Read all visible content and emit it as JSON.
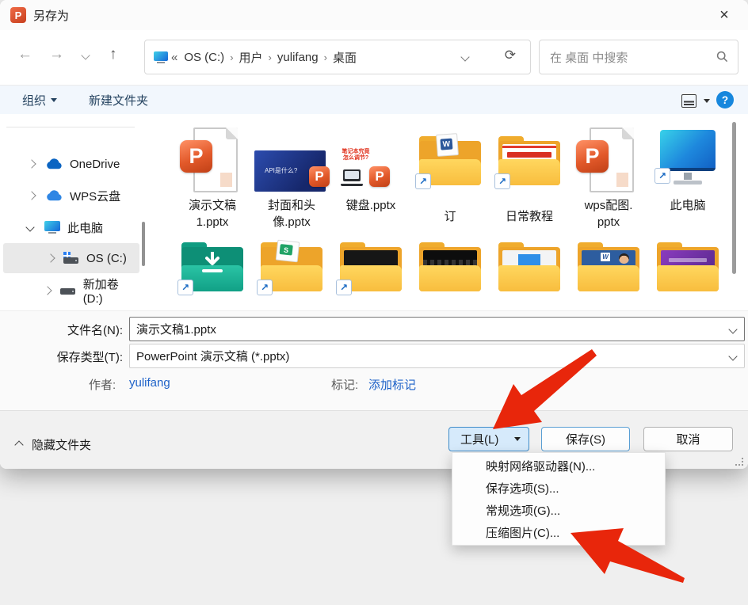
{
  "window": {
    "title": "另存为"
  },
  "nav": {
    "address": {
      "root": "«",
      "separator": "›",
      "crumbs": [
        "OS (C:)",
        "用户",
        "yulifang",
        "桌面"
      ]
    },
    "search_placeholder": "在 桌面 中搜索"
  },
  "toolbar": {
    "organize": "组织",
    "new_folder": "新建文件夹"
  },
  "sidebar": {
    "items": [
      {
        "label": "OneDrive"
      },
      {
        "label": "WPS云盘"
      },
      {
        "label": "此电脑"
      },
      {
        "label": "OS (C:)"
      },
      {
        "label": "新加卷 (D:)"
      }
    ]
  },
  "files": {
    "row1": [
      {
        "name": "演示文稿1.pptx",
        "line1": "演示文稿",
        "line2": "1.pptx"
      },
      {
        "name": "封面和头像.pptx",
        "line1": "封面和头",
        "line2": "像.pptx",
        "thumb_text": "API是什么?"
      },
      {
        "name": "键盘.pptx",
        "line1": "键盘.pptx",
        "line2": "",
        "thumb_line1": "笔记本究竟",
        "thumb_line2": "怎么调节?"
      },
      {
        "name": "订",
        "line1": "订",
        "line2": ""
      },
      {
        "name": "日常教程",
        "line1": "日常教程",
        "line2": ""
      },
      {
        "name": "wps配图.pptx",
        "line1": "wps配图.",
        "line2": "pptx"
      },
      {
        "name": "此电脑",
        "line1": "此电脑",
        "line2": ""
      }
    ],
    "row2": [
      {
        "type": "teal-download-folder"
      },
      {
        "type": "spreadsheet-folder"
      },
      {
        "type": "dark-content-folder"
      },
      {
        "type": "keyboard-folder"
      },
      {
        "type": "presentation-folder"
      },
      {
        "type": "word-avatar-folder"
      },
      {
        "type": "purple-folder"
      }
    ]
  },
  "fields": {
    "filename_label": "文件名(N):",
    "filename_value": "演示文稿1.pptx",
    "savetype_label": "保存类型(T):",
    "savetype_value": "PowerPoint 演示文稿 (*.pptx)",
    "author_label": "作者:",
    "author_value": "yulifang",
    "tags_label": "标记:",
    "tags_value": "添加标记"
  },
  "footer": {
    "hide_folders": "隐藏文件夹",
    "tools": "工具(L)",
    "save": "保存(S)",
    "cancel": "取消"
  },
  "menu": {
    "items": [
      "映射网络驱动器(N)...",
      "保存选项(S)...",
      "常规选项(G)...",
      "压缩图片(C)..."
    ]
  },
  "glyphs": {
    "back": "←",
    "forward": "→",
    "up": "↑",
    "refresh": "⟳",
    "close": "×",
    "shortcut": "↗",
    "p_letter": "P",
    "w_letter": "W",
    "s_letter": "S",
    "help": "?"
  },
  "colors": {
    "accent": "#1787dd",
    "arrow_red": "#e8260b",
    "folder_yellow": "#f8bd3e"
  }
}
